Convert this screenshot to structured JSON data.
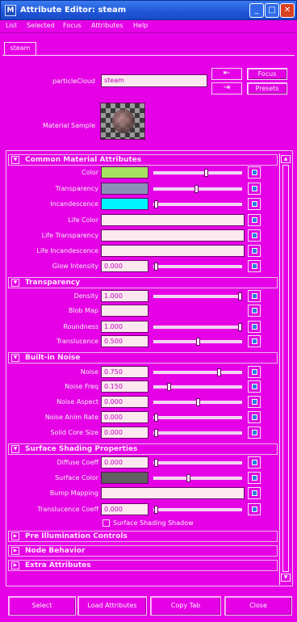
{
  "window": {
    "title": "Attribute Editor: steam"
  },
  "menu": [
    "List",
    "Selected",
    "Focus",
    "Attributes",
    "Help"
  ],
  "tab": "steam",
  "header": {
    "particle_label": "particleCloud",
    "particle_value": "steam",
    "focus_label": "Focus",
    "presets_label": "Presets",
    "material_sample_label": "Material Sample"
  },
  "sections": {
    "common": {
      "title": "Common Material Attributes"
    },
    "transparency": {
      "title": "Transparency"
    },
    "noise": {
      "title": "Built-in Noise"
    },
    "shading": {
      "title": "Surface Shading Properties"
    },
    "pre_illum": {
      "title": "Pre Illumination Controls"
    },
    "node_behavior": {
      "title": "Node Behavior"
    },
    "extra": {
      "title": "Extra Attributes"
    }
  },
  "rows": {
    "color": {
      "label": "Color",
      "swatch": "#a8e060",
      "level": 0.6
    },
    "transparency": {
      "label": "Transparency",
      "swatch": "#8a90b8",
      "level": 0.48
    },
    "incandescence": {
      "label": "Incandescence",
      "swatch": "#00f4ff",
      "level": 0.0
    },
    "life_color": {
      "label": "Life Color"
    },
    "life_transparency": {
      "label": "Life Transparency"
    },
    "life_incandescence": {
      "label": "Life Incandescence"
    },
    "glow": {
      "label": "Glow Intensity",
      "value": "0.000",
      "level": 0.0
    },
    "density": {
      "label": "Density",
      "value": "1.000",
      "level": 1.0
    },
    "blob_map": {
      "label": "Blob Map"
    },
    "roundness": {
      "label": "Roundness",
      "value": "1.000",
      "level": 1.0
    },
    "translucence": {
      "label": "Translucence",
      "value": "0.500",
      "level": 0.5
    },
    "noise": {
      "label": "Noise",
      "value": "0.750",
      "level": 0.75
    },
    "noise_freq": {
      "label": "Noise Freq",
      "value": "0.150",
      "level": 0.15
    },
    "noise_aspect": {
      "label": "Noise Aspect",
      "value": "0.000",
      "level": 0.5
    },
    "noise_anim": {
      "label": "Noise Anim Rate",
      "value": "0.000",
      "level": 0.0
    },
    "solid_core": {
      "label": "Solid Core Size",
      "value": "0.000",
      "level": 0.0
    },
    "diffuse": {
      "label": "Diffuse Coeff",
      "value": "0.000",
      "level": 0.0
    },
    "surface_color": {
      "label": "Surface Color",
      "swatch": "#606060",
      "level": 0.38
    },
    "bump": {
      "label": "Bump Mapping"
    },
    "translucence_coeff": {
      "label": "Translucence Coeff",
      "value": "0.000",
      "level": 0.0
    },
    "surface_shadow": {
      "label": "Surface Shading Shadow"
    }
  },
  "buttons": {
    "select": "Select",
    "load": "Load Attributes",
    "copy": "Copy Tab",
    "close": "Close"
  }
}
